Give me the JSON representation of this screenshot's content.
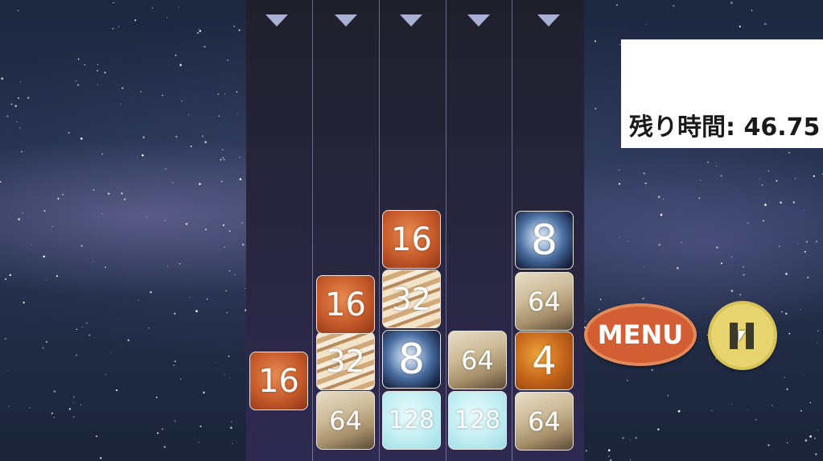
{
  "columns": [
    {
      "tiles": [
        {
          "value": "16",
          "planet": "mars"
        }
      ]
    },
    {
      "tiles": [
        {
          "value": "64",
          "planet": "saturn"
        },
        {
          "value": "32",
          "planet": "jupiter"
        },
        {
          "value": "16",
          "planet": "mars"
        }
      ]
    },
    {
      "tiles": [
        {
          "value": "128",
          "planet": "uranus"
        },
        {
          "value": "8",
          "planet": "earth"
        },
        {
          "value": "32",
          "planet": "jupiter"
        },
        {
          "value": "16",
          "planet": "mars"
        }
      ]
    },
    {
      "tiles": [
        {
          "value": "128",
          "planet": "uranus"
        },
        {
          "value": "64",
          "planet": "saturn"
        }
      ]
    },
    {
      "tiles": [
        {
          "value": "64",
          "planet": "saturn"
        },
        {
          "value": "4",
          "planet": "venus"
        },
        {
          "value": "64",
          "planet": "saturn"
        },
        {
          "value": "8",
          "planet": "earth"
        }
      ]
    }
  ],
  "timer": {
    "text": "残り時間: 46.75"
  },
  "menu": {
    "label": "MENU"
  },
  "pause": {
    "icon": "pause-icon"
  },
  "colors": {
    "menu": "#d45e34",
    "pause": "#e8d46e",
    "arrow": "#aab0d4"
  }
}
